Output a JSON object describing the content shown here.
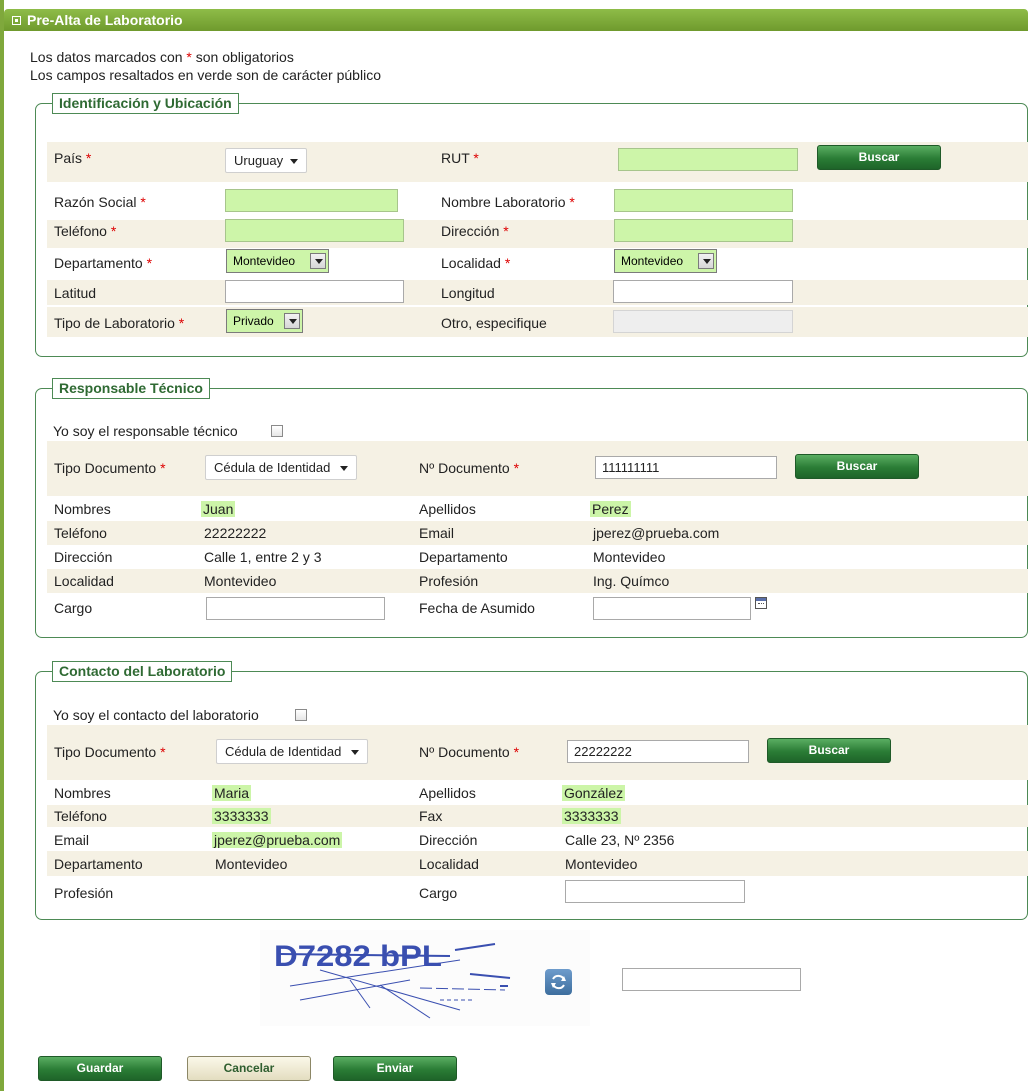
{
  "header": {
    "title": "Pre-Alta de Laboratorio"
  },
  "intro": {
    "line1_a": "Los datos marcados con ",
    "asterisk": "*",
    "line1_b": " son obligatorios",
    "line2": "Los campos resaltados en verde son de carácter público"
  },
  "section1": {
    "title": "Identificación y Ubicación",
    "pais_label": "País",
    "pais_value": "Uruguay",
    "rut_label": "RUT",
    "rut_value": "",
    "buscar_label": "Buscar",
    "razon_label": "Razón Social",
    "razon_value": "",
    "nombre_lab_label": "Nombre Laboratorio",
    "nombre_lab_value": "",
    "telefono_label": "Teléfono",
    "telefono_value": "",
    "direccion_label": "Dirección",
    "direccion_value": "",
    "departamento_label": "Departamento",
    "departamento_value": "Montevideo",
    "localidad_label": "Localidad",
    "localidad_value": "Montevideo",
    "latitud_label": "Latitud",
    "latitud_value": "",
    "longitud_label": "Longitud",
    "longitud_value": "",
    "tipo_lab_label": "Tipo de Laboratorio",
    "tipo_lab_value": "Privado",
    "otro_label": "Otro, especifique",
    "otro_value": ""
  },
  "section2": {
    "title": "Responsable Técnico",
    "checkbox_label": "Yo soy el responsable técnico",
    "tipo_doc_label": "Tipo Documento",
    "tipo_doc_value": "Cédula de Identidad",
    "nro_doc_label": "Nº Documento",
    "nro_doc_value": "111111111",
    "buscar_label": "Buscar",
    "nombres_label": "Nombres",
    "nombres_value": "Juan",
    "apellidos_label": "Apellidos",
    "apellidos_value": "Perez",
    "telefono_label": "Teléfono",
    "telefono_value": "22222222",
    "email_label": "Email",
    "email_value": "jperez@prueba.com",
    "direccion_label": "Dirección",
    "direccion_value": "Calle 1, entre 2 y 3",
    "departamento_label": "Departamento",
    "departamento_value": "Montevideo",
    "localidad_label": "Localidad",
    "localidad_value": "Montevideo",
    "profesion_label": "Profesión",
    "profesion_value": "Ing. Químco",
    "cargo_label": "Cargo",
    "cargo_value": "",
    "fecha_label": "Fecha de Asumido",
    "fecha_value": ""
  },
  "section3": {
    "title": "Contacto del Laboratorio",
    "checkbox_label": "Yo soy el contacto del laboratorio",
    "tipo_doc_label": "Tipo Documento",
    "tipo_doc_value": "Cédula de Identidad",
    "nro_doc_label": "Nº Documento",
    "nro_doc_value": "22222222",
    "buscar_label": "Buscar",
    "nombres_label": "Nombres",
    "nombres_value": "Maria",
    "apellidos_label": "Apellidos",
    "apellidos_value": "González",
    "telefono_label": "Teléfono",
    "telefono_value": "3333333",
    "fax_label": "Fax",
    "fax_value": "3333333",
    "email_label": "Email",
    "email_value": "jperez@prueba.com",
    "direccion_label": "Dirección",
    "direccion_value": "Calle 23, Nº 2356",
    "departamento_label": "Departamento",
    "departamento_value": "Montevideo",
    "localidad_label": "Localidad",
    "localidad_value": "Montevideo",
    "profesion_label": "Profesión",
    "cargo_label": "Cargo",
    "cargo_value": ""
  },
  "captcha": {
    "text": "D7282 bPL",
    "answer_value": ""
  },
  "footer": {
    "guardar": "Guardar",
    "cancelar": "Cancelar",
    "enviar": "Enviar"
  },
  "colors": {
    "header_green": "#7fa83c",
    "public_field": "#cdf5a9",
    "button_green": "#2a7c35",
    "required": "#dd0000"
  },
  "icons": {
    "header": "square-bullet-icon",
    "calendar": "calendar-icon",
    "refresh": "refresh-icon",
    "dropdown": "caret-down-icon"
  }
}
